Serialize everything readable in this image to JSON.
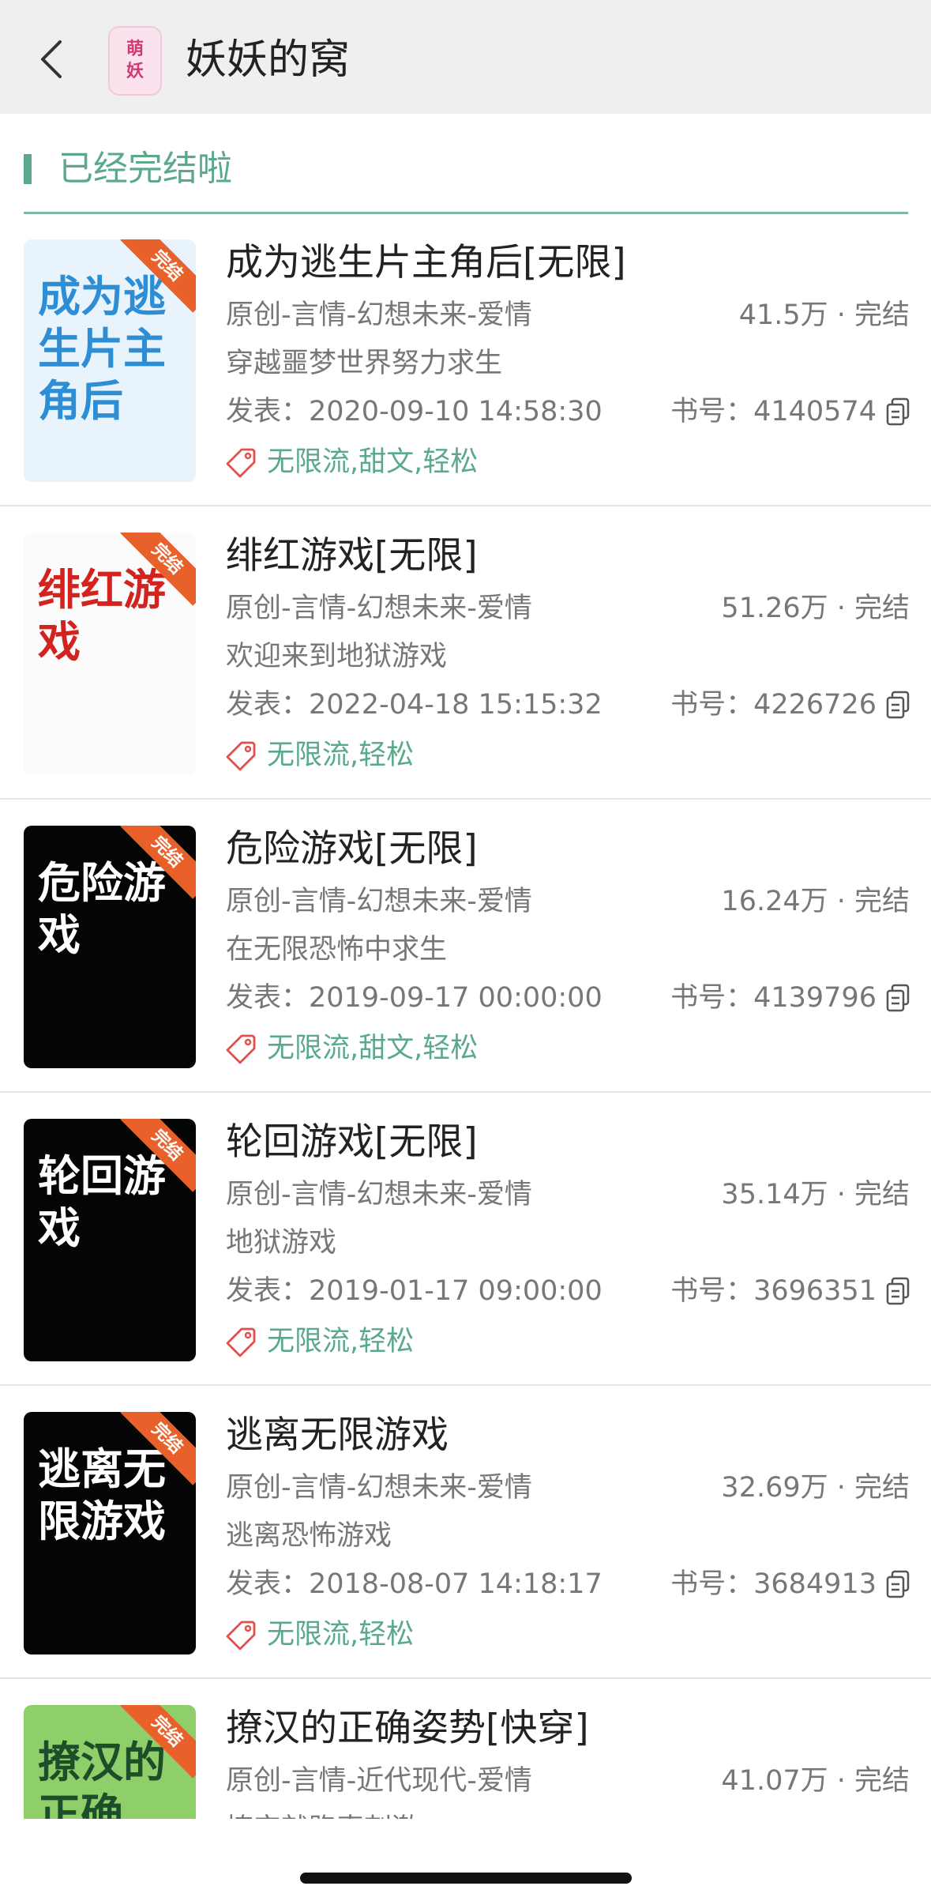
{
  "header": {
    "title": "妖妖的窝",
    "avatar_text": [
      "萌",
      "妖"
    ]
  },
  "section": {
    "title": "已经完结啦"
  },
  "books": [
    {
      "title": "成为逃生片主角后[无限]",
      "category": "原创-言情-幻想未来-爱情",
      "words": "41.5万 · 完结",
      "desc": "穿越噩梦世界努力求生",
      "date": "发表：2020-09-10 14:58:30",
      "id": "书号：4140574",
      "tags": "无限流,甜文,轻松",
      "status": "完结",
      "cover_text": "成为逃生片主角后",
      "cover_bg": "#e9f3fb",
      "cover_fg": "#2d8ed6"
    },
    {
      "title": "绯红游戏[无限]",
      "category": "原创-言情-幻想未来-爱情",
      "words": "51.26万 · 完结",
      "desc": "欢迎来到地狱游戏",
      "date": "发表：2022-04-18 15:15:32",
      "id": "书号：4226726",
      "tags": "无限流,轻松",
      "status": "完结",
      "cover_text": "绯红游戏",
      "cover_bg": "#fbfbfb",
      "cover_fg": "#d2231f"
    },
    {
      "title": "危险游戏[无限]",
      "category": "原创-言情-幻想未来-爱情",
      "words": "16.24万 · 完结",
      "desc": "在无限恐怖中求生",
      "date": "发表：2019-09-17 00:00:00",
      "id": "书号：4139796",
      "tags": "无限流,甜文,轻松",
      "status": "完结",
      "cover_text": "危险游戏",
      "cover_bg": "#050505",
      "cover_fg": "#ffffff"
    },
    {
      "title": "轮回游戏[无限]",
      "category": "原创-言情-幻想未来-爱情",
      "words": "35.14万 · 完结",
      "desc": "地狱游戏",
      "date": "发表：2019-01-17 09:00:00",
      "id": "书号：3696351",
      "tags": "无限流,轻松",
      "status": "完结",
      "cover_text": "轮回游戏",
      "cover_bg": "#050505",
      "cover_fg": "#ffffff"
    },
    {
      "title": "逃离无限游戏",
      "category": "原创-言情-幻想未来-爱情",
      "words": "32.69万 · 完结",
      "desc": "逃离恐怖游戏",
      "date": "发表：2018-08-07 14:18:17",
      "id": "书号：3684913",
      "tags": "无限流,轻松",
      "status": "完结",
      "cover_text": "逃离无限游戏",
      "cover_bg": "#050505",
      "cover_fg": "#ffffff"
    },
    {
      "title": "撩汉的正确姿势[快穿]",
      "category": "原创-言情-近代现代-爱情",
      "words": "41.07万 · 完结",
      "desc": "撩完就跑真刺激",
      "date": "",
      "id": "",
      "tags": "",
      "status": "完结",
      "cover_text": "撩汉的正确",
      "cover_bg": "#8fcf6a",
      "cover_fg": "#1d4e2a"
    }
  ],
  "colors": {
    "accent": "#5aa98a",
    "corner_ribbon": "#e8612b",
    "tag_icon": "#e2504d"
  }
}
